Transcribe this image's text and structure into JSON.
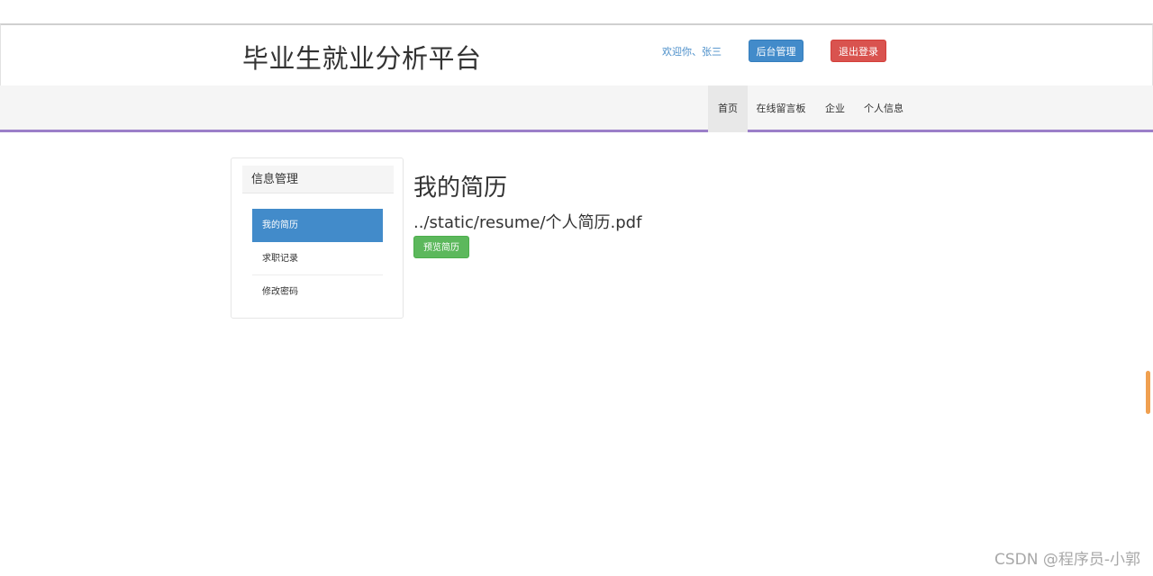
{
  "header": {
    "site_title": "毕业生就业分析平台",
    "welcome_text": "欢迎你、张三",
    "admin_button": "后台管理",
    "logout_button": "退出登录"
  },
  "nav": {
    "items": [
      "首页",
      "在线留言板",
      "企业",
      "个人信息"
    ],
    "active": "首页"
  },
  "sidebar": {
    "heading": "信息管理",
    "items": [
      "我的简历",
      "求职记录",
      "修改密码"
    ],
    "active": "我的简历"
  },
  "main": {
    "title": "我的简历",
    "resume_path": "../static/resume/个人简历.pdf",
    "preview_button": "预览简历"
  },
  "watermark": "CSDN @程序员-小郭",
  "colors": {
    "primary": "#428bca",
    "danger": "#d9534f",
    "success": "#5cb85c",
    "nav_accent": "#9b7fc8",
    "scroll_handle": "#f0a050"
  }
}
